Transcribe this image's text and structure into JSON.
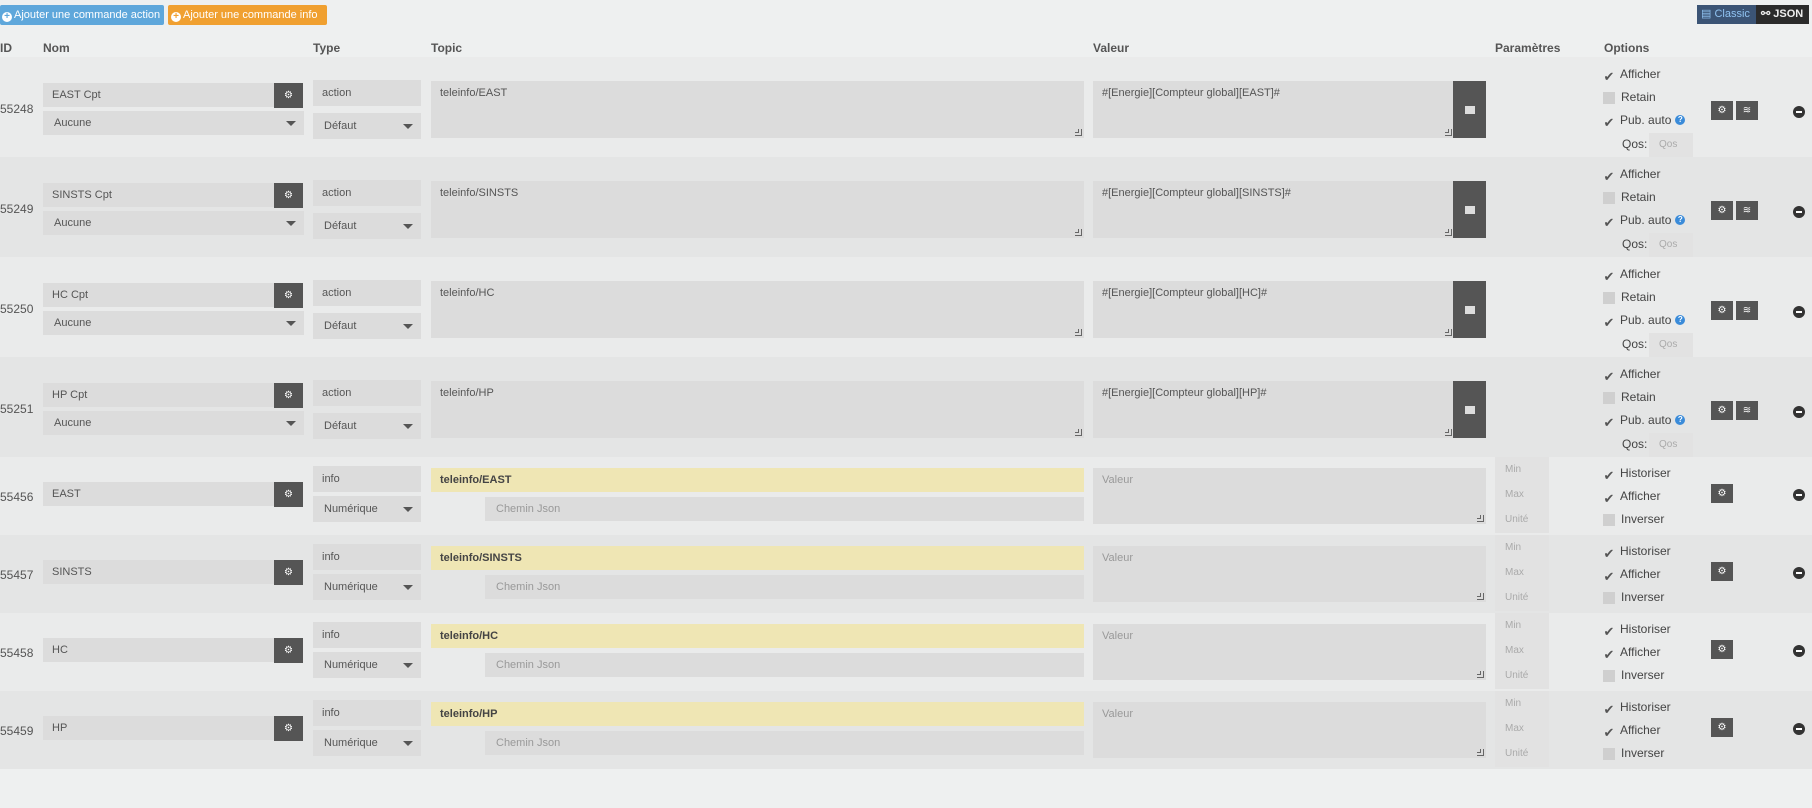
{
  "toolbar": {
    "add_action": "Ajouter une commande action",
    "add_info": "Ajouter une commande info",
    "view_classic": "Classic",
    "view_json": "JSON"
  },
  "headers": {
    "id": "ID",
    "nom": "Nom",
    "type": "Type",
    "topic": "Topic",
    "valeur": "Valeur",
    "parametres": "Paramètres",
    "options": "Options"
  },
  "labels": {
    "afficher": "Afficher",
    "retain": "Retain",
    "pub_auto": "Pub. auto",
    "qos": "Qos:",
    "qos_placeholder": "Qos",
    "historiser": "Historiser",
    "inverser": "Inverser",
    "min": "Min",
    "max": "Max",
    "unite": "Unité",
    "valeur_placeholder": "Valeur",
    "chemin_placeholder": "Chemin Json"
  },
  "action_rows": [
    {
      "id": "55248",
      "name": "EAST Cpt",
      "sub": "Aucune",
      "type": "action",
      "subtype": "Défaut",
      "topic": "teleinfo/EAST",
      "value": "#[Energie][Compteur global][EAST]#",
      "afficher": true,
      "retain": false,
      "pub_auto": true
    },
    {
      "id": "55249",
      "name": "SINSTS Cpt",
      "sub": "Aucune",
      "type": "action",
      "subtype": "Défaut",
      "topic": "teleinfo/SINSTS",
      "value": "#[Energie][Compteur global][SINSTS]#",
      "afficher": true,
      "retain": false,
      "pub_auto": true
    },
    {
      "id": "55250",
      "name": "HC Cpt",
      "sub": "Aucune",
      "type": "action",
      "subtype": "Défaut",
      "topic": "teleinfo/HC",
      "value": "#[Energie][Compteur global][HC]#",
      "afficher": true,
      "retain": false,
      "pub_auto": true
    },
    {
      "id": "55251",
      "name": "HP Cpt",
      "sub": "Aucune",
      "type": "action",
      "subtype": "Défaut",
      "topic": "teleinfo/HP",
      "value": " #[Energie][Compteur global][HP]#",
      "afficher": true,
      "retain": false,
      "pub_auto": true
    }
  ],
  "info_rows": [
    {
      "id": "55456",
      "name": "EAST",
      "type": "info",
      "subtype": "Numérique",
      "topic": "teleinfo/EAST",
      "historiser": true,
      "afficher": true,
      "inverser": false
    },
    {
      "id": "55457",
      "name": "SINSTS",
      "type": "info",
      "subtype": "Numérique",
      "topic": "teleinfo/SINSTS",
      "historiser": true,
      "afficher": true,
      "inverser": false
    },
    {
      "id": "55458",
      "name": "HC",
      "type": "info",
      "subtype": "Numérique",
      "topic": "teleinfo/HC",
      "historiser": true,
      "afficher": true,
      "inverser": false
    },
    {
      "id": "55459",
      "name": "HP",
      "type": "info",
      "subtype": "Numérique",
      "topic": "teleinfo/HP",
      "historiser": true,
      "afficher": true,
      "inverser": false
    }
  ]
}
